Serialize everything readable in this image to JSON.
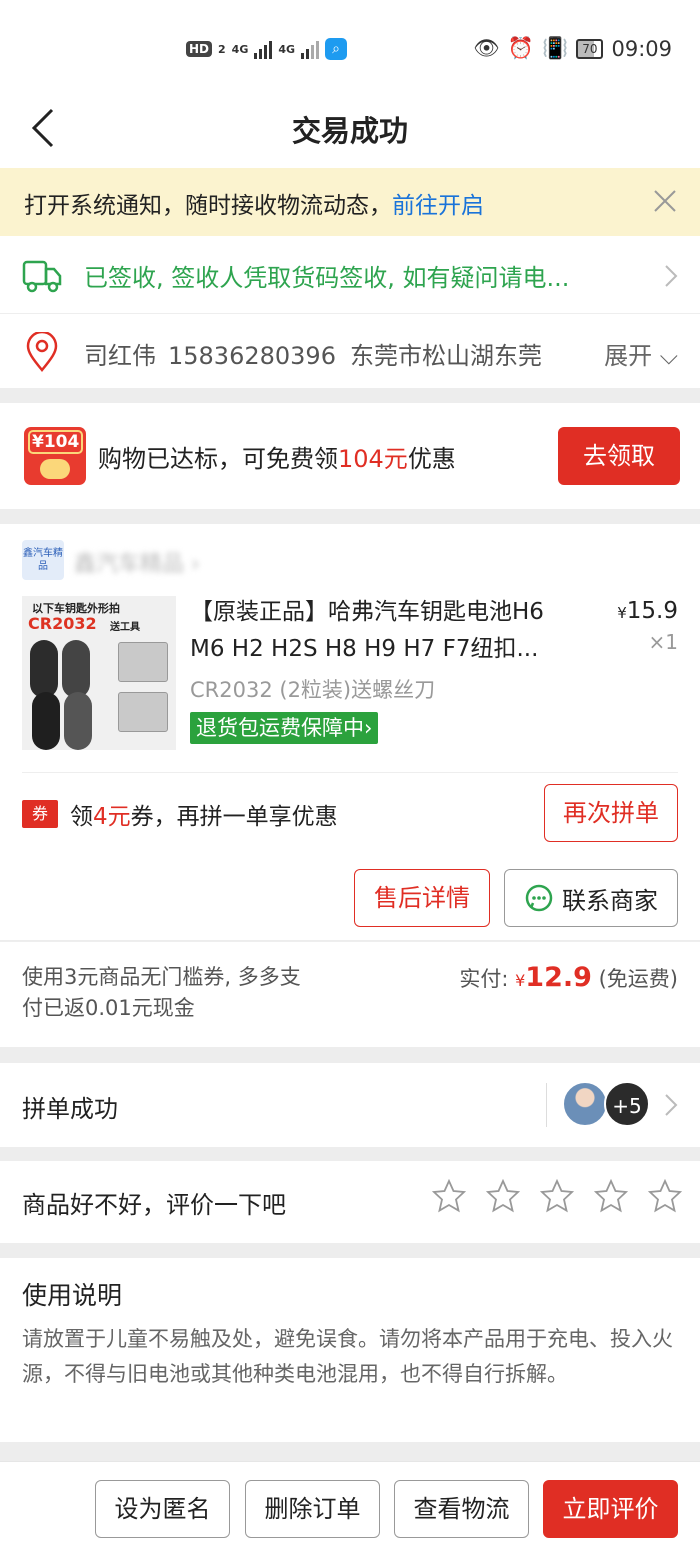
{
  "status_bar": {
    "hd": "HD",
    "hd_sub": "2",
    "net1": "4G",
    "net2": "4G",
    "battery": "70",
    "time": "09:09"
  },
  "nav": {
    "title": "交易成功"
  },
  "notice": {
    "text": "打开系统通知，随时接收物流动态，",
    "link": "前往开启"
  },
  "logistics": {
    "status": "已签收, 签收人凭取货码签收, 如有疑问请电..."
  },
  "address": {
    "name": "司红伟",
    "phone": "15836280396",
    "addr": "东莞市松山湖东莞",
    "expand": "展开"
  },
  "coupon": {
    "icon_label": "¥104",
    "text_pre": "购物已达标，可免费领",
    "amount": "104元",
    "text_post": "优惠",
    "button": "去领取"
  },
  "shop": {
    "logo_text": "鑫汽车精品",
    "name": "鑫汽车精品 ›"
  },
  "product": {
    "img_caption": "以下车钥匙外形拍",
    "img_model": "CR2032",
    "img_tool": "送工具",
    "title": "【原装正品】哈弗汽车钥匙电池H6 M6 H2 H2S H8 H9 H7 F7纽扣...",
    "price_symbol": "¥",
    "price": "15.9",
    "qty": "×1",
    "spec": "CR2032 (2粒装)送螺丝刀",
    "return_tag": "退货包运费保障中›"
  },
  "regroup": {
    "badge": "券",
    "text_pre": "领",
    "amount": "4元",
    "text_post": "券，再拼一单享优惠",
    "button": "再次拼单"
  },
  "actions": {
    "aftersale": "售后详情",
    "contact": "联系商家"
  },
  "payment": {
    "note": "使用3元商品无门槛券, 多多支付已返0.01元现金",
    "label": "实付:",
    "symbol": "¥",
    "amount": "12.9",
    "shipping": "(免运费)"
  },
  "group": {
    "title": "拼单成功",
    "more": "+5"
  },
  "review": {
    "title": "商品好不好，评价一下吧",
    "stars": 0
  },
  "usage": {
    "title": "使用说明",
    "body": "请放置于儿童不易触及处，避免误食。请勿将本产品用于充电、投入火源，不得与旧电池或其他种类电池混用，也不得自行拆解。"
  },
  "bottom_bar": {
    "anonymous": "设为匿名",
    "delete": "删除订单",
    "logistics": "查看物流",
    "review": "立即评价"
  },
  "colors": {
    "accent_red": "#e02e24",
    "success_green": "#2ea44f",
    "link_blue": "#1a73d9",
    "notice_bg": "#fbf3cf"
  }
}
